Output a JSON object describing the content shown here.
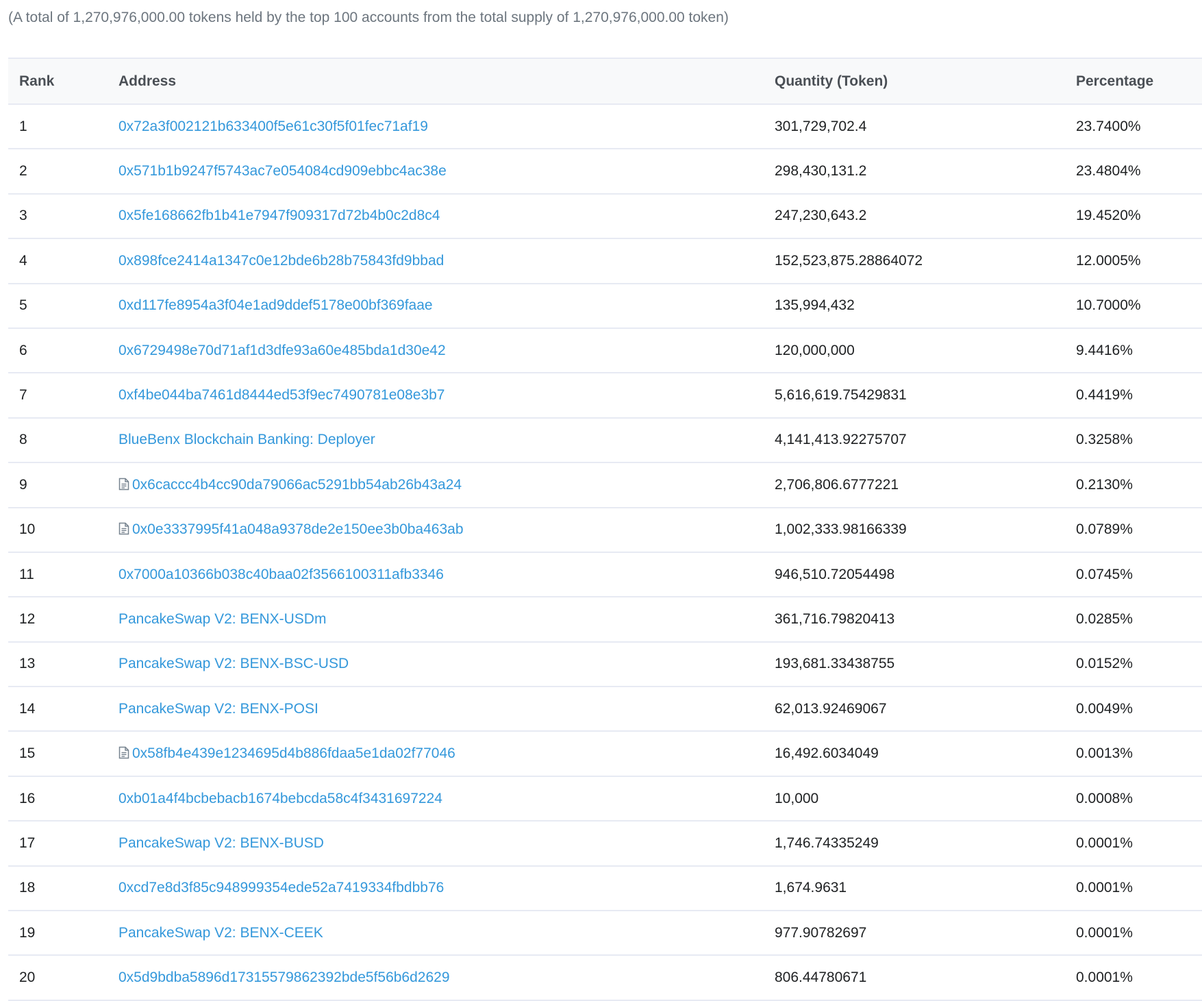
{
  "summary_text": "(A total of 1,270,976,000.00 tokens held by the top 100 accounts from the total supply of 1,270,976,000.00 token)",
  "colors": {
    "link": "#3498db",
    "header_background": "#f8f9fa",
    "border": "#e7eaf3",
    "summary_text": "#6c757e"
  },
  "table": {
    "headers": {
      "rank": "Rank",
      "address": "Address",
      "quantity": "Quantity (Token)",
      "percentage": "Percentage"
    },
    "rows": [
      {
        "rank": "1",
        "address": "0x72a3f002121b633400f5e61c30f5f01fec71af19",
        "contract": false,
        "quantity": "301,729,702.4",
        "percentage": "23.7400%"
      },
      {
        "rank": "2",
        "address": "0x571b1b9247f5743ac7e054084cd909ebbc4ac38e",
        "contract": false,
        "quantity": "298,430,131.2",
        "percentage": "23.4804%"
      },
      {
        "rank": "3",
        "address": "0x5fe168662fb1b41e7947f909317d72b4b0c2d8c4",
        "contract": false,
        "quantity": "247,230,643.2",
        "percentage": "19.4520%"
      },
      {
        "rank": "4",
        "address": "0x898fce2414a1347c0e12bde6b28b75843fd9bbad",
        "contract": false,
        "quantity": "152,523,875.28864072",
        "percentage": "12.0005%"
      },
      {
        "rank": "5",
        "address": "0xd117fe8954a3f04e1ad9ddef5178e00bf369faae",
        "contract": false,
        "quantity": "135,994,432",
        "percentage": "10.7000%"
      },
      {
        "rank": "6",
        "address": "0x6729498e70d71af1d3dfe93a60e485bda1d30e42",
        "contract": false,
        "quantity": "120,000,000",
        "percentage": "9.4416%"
      },
      {
        "rank": "7",
        "address": "0xf4be044ba7461d8444ed53f9ec7490781e08e3b7",
        "contract": false,
        "quantity": "5,616,619.75429831",
        "percentage": "0.4419%"
      },
      {
        "rank": "8",
        "address": "BlueBenx Blockchain Banking: Deployer",
        "contract": false,
        "quantity": "4,141,413.92275707",
        "percentage": "0.3258%"
      },
      {
        "rank": "9",
        "address": "0x6caccc4b4cc90da79066ac5291bb54ab26b43a24",
        "contract": true,
        "quantity": "2,706,806.6777221",
        "percentage": "0.2130%"
      },
      {
        "rank": "10",
        "address": "0x0e3337995f41a048a9378de2e150ee3b0ba463ab",
        "contract": true,
        "quantity": "1,002,333.98166339",
        "percentage": "0.0789%"
      },
      {
        "rank": "11",
        "address": "0x7000a10366b038c40baa02f3566100311afb3346",
        "contract": false,
        "quantity": "946,510.72054498",
        "percentage": "0.0745%"
      },
      {
        "rank": "12",
        "address": "PancakeSwap V2: BENX-USDm",
        "contract": false,
        "quantity": "361,716.79820413",
        "percentage": "0.0285%"
      },
      {
        "rank": "13",
        "address": "PancakeSwap V2: BENX-BSC-USD",
        "contract": false,
        "quantity": "193,681.33438755",
        "percentage": "0.0152%"
      },
      {
        "rank": "14",
        "address": "PancakeSwap V2: BENX-POSI",
        "contract": false,
        "quantity": "62,013.92469067",
        "percentage": "0.0049%"
      },
      {
        "rank": "15",
        "address": "0x58fb4e439e1234695d4b886fdaa5e1da02f77046",
        "contract": true,
        "quantity": "16,492.6034049",
        "percentage": "0.0013%"
      },
      {
        "rank": "16",
        "address": "0xb01a4f4bcbebacb1674bebcda58c4f3431697224",
        "contract": false,
        "quantity": "10,000",
        "percentage": "0.0008%"
      },
      {
        "rank": "17",
        "address": "PancakeSwap V2: BENX-BUSD",
        "contract": false,
        "quantity": "1,746.74335249",
        "percentage": "0.0001%"
      },
      {
        "rank": "18",
        "address": "0xcd7e8d3f85c948999354ede52a7419334fbdbb76",
        "contract": false,
        "quantity": "1,674.9631",
        "percentage": "0.0001%"
      },
      {
        "rank": "19",
        "address": "PancakeSwap V2: BENX-CEEK",
        "contract": false,
        "quantity": "977.90782697",
        "percentage": "0.0001%"
      },
      {
        "rank": "20",
        "address": "0x5d9bdba5896d17315579862392bde5f56b6d2629",
        "contract": false,
        "quantity": "806.44780671",
        "percentage": "0.0001%"
      }
    ]
  },
  "icons": {
    "contract": "file-text-icon"
  }
}
